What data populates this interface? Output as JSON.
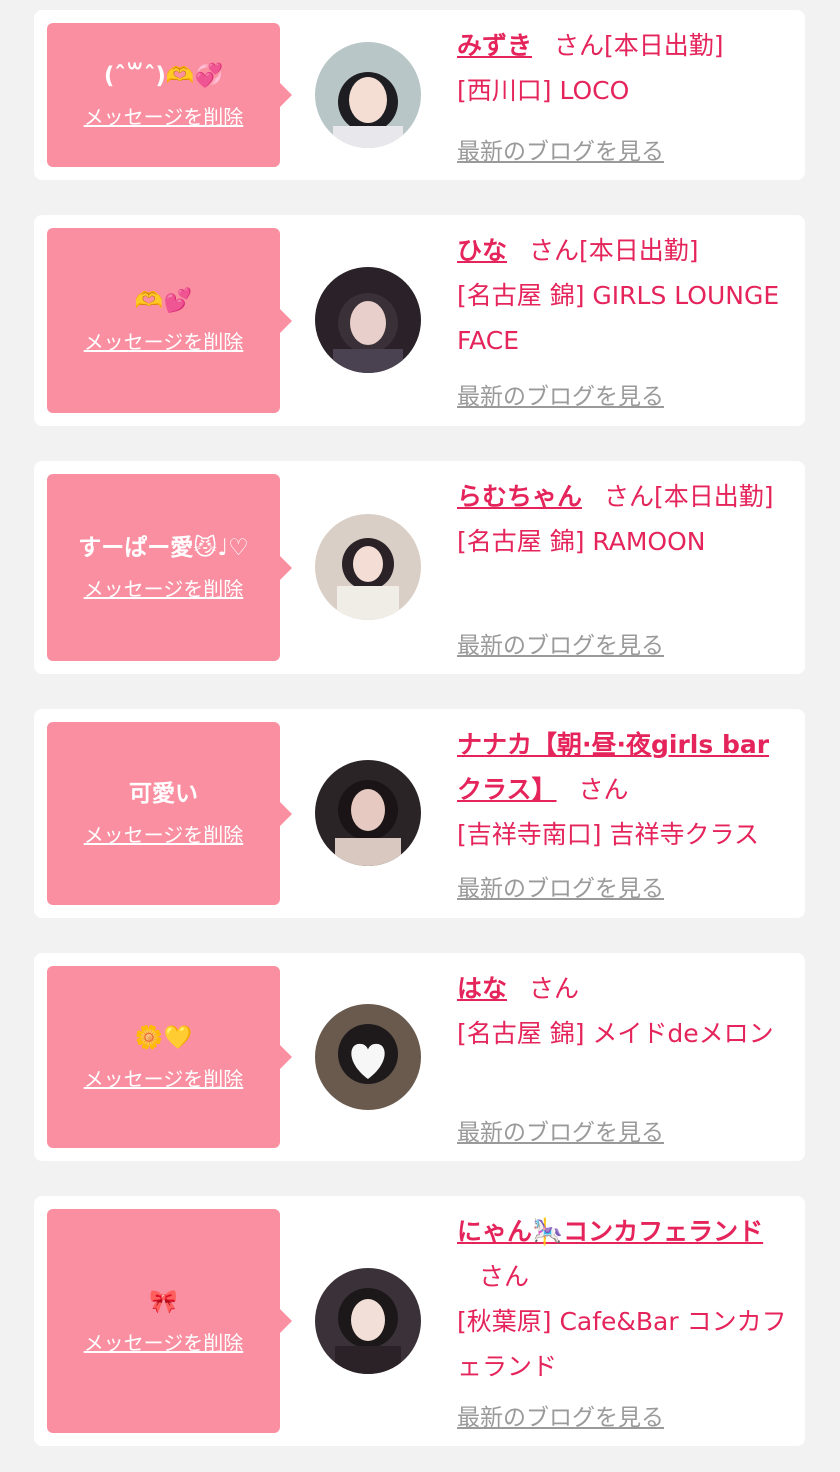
{
  "colors": {
    "accent": "#e4245a",
    "bubble": "#f98fa0",
    "card": "#ffffff",
    "background": "#f2f2f2",
    "blog_link": "#9a9a9a"
  },
  "entries": [
    {
      "message": "(ˆ꒳ˆ)🫶💞",
      "delete_label": "メッセージを削除",
      "name": "みずき",
      "suffix": "さん",
      "status": "[本日出勤]",
      "location": "[西川口] LOCO",
      "blog_label": "最新のブログを見る"
    },
    {
      "message": "🫶💕",
      "delete_label": "メッセージを削除",
      "name": "ひな",
      "suffix": "さん",
      "status": "[本日出勤]",
      "location": "[名古屋 錦] GIRLS LOUNGE FACE",
      "blog_label": "最新のブログを見る"
    },
    {
      "message": "すーぱー愛😼♩♡",
      "delete_label": "メッセージを削除",
      "name": "らむちゃん",
      "suffix": "さん",
      "status": "[本日出勤]",
      "location": "[名古屋 錦] RAMOON",
      "blog_label": "最新のブログを見る"
    },
    {
      "message": "可愛い",
      "delete_label": "メッセージを削除",
      "name": "ナナカ【朝·昼·夜girls bar クラス】",
      "suffix": "さん",
      "status": "",
      "location": "[吉祥寺南口] 吉祥寺クラス",
      "blog_label": "最新のブログを見る"
    },
    {
      "message": "🌼💛",
      "delete_label": "メッセージを削除",
      "name": "はな",
      "suffix": "さん",
      "status": "",
      "location": "[名古屋 錦] メイドdeメロン",
      "blog_label": "最新のブログを見る"
    },
    {
      "message": "🎀",
      "delete_label": "メッセージを削除",
      "name": "にゃん🎠コンカフェランド",
      "suffix": "さん",
      "status": "",
      "location": "[秋葉原] Cafe&Bar コンカフェランド",
      "blog_label": "最新のブログを見る"
    }
  ]
}
